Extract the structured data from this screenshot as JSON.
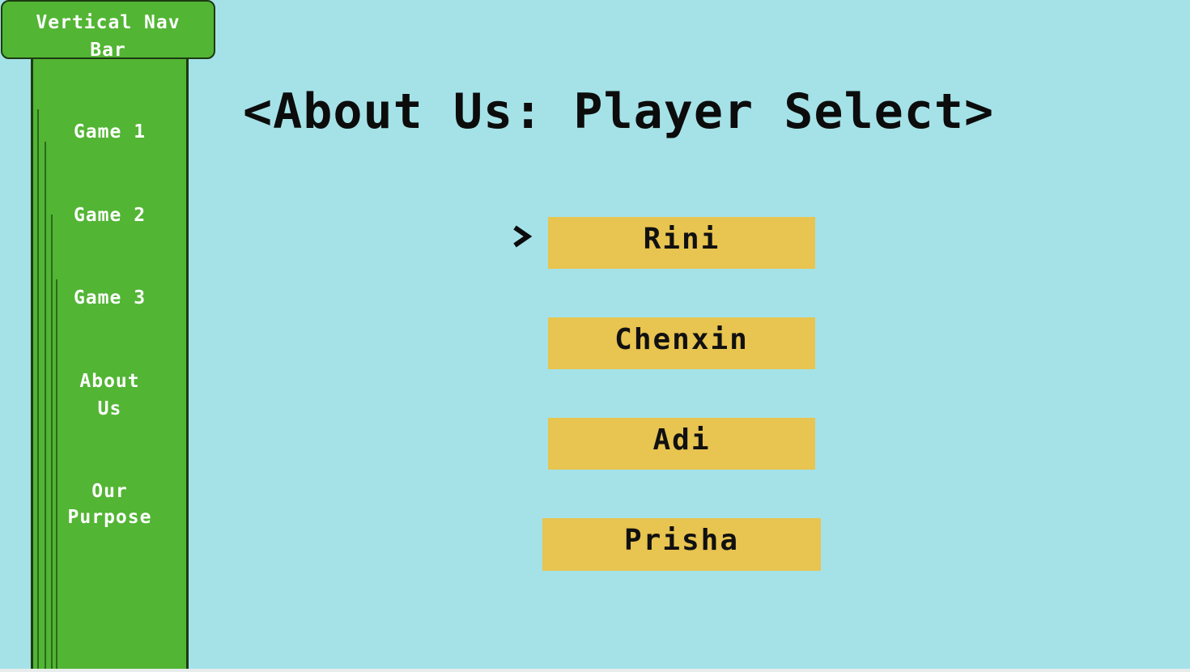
{
  "nav": {
    "title_line1": "Vertical Nav",
    "title_line2": "Bar",
    "items": [
      {
        "label": "Game 1"
      },
      {
        "label": "Game 2"
      },
      {
        "label": "Game 3"
      },
      {
        "label_line1": "About",
        "label_line2": "Us"
      },
      {
        "label_line1": "Our",
        "label_line2": "Purpose"
      }
    ]
  },
  "main": {
    "title": "<About Us: Player Select>",
    "selected_player": "Rini",
    "players": [
      {
        "name": "Rini"
      },
      {
        "name": "Chenxin"
      },
      {
        "name": "Adi"
      },
      {
        "name": "Prisha"
      }
    ]
  },
  "colors": {
    "background": "#a5e2e8",
    "pipe_green": "#52b534",
    "pipe_outline": "#1d3a12",
    "button_yellow": "#e8c450",
    "text_dark": "#0c0c0c",
    "text_light": "#ffffff"
  },
  "icons": {
    "selector": "chevron-right-icon"
  }
}
